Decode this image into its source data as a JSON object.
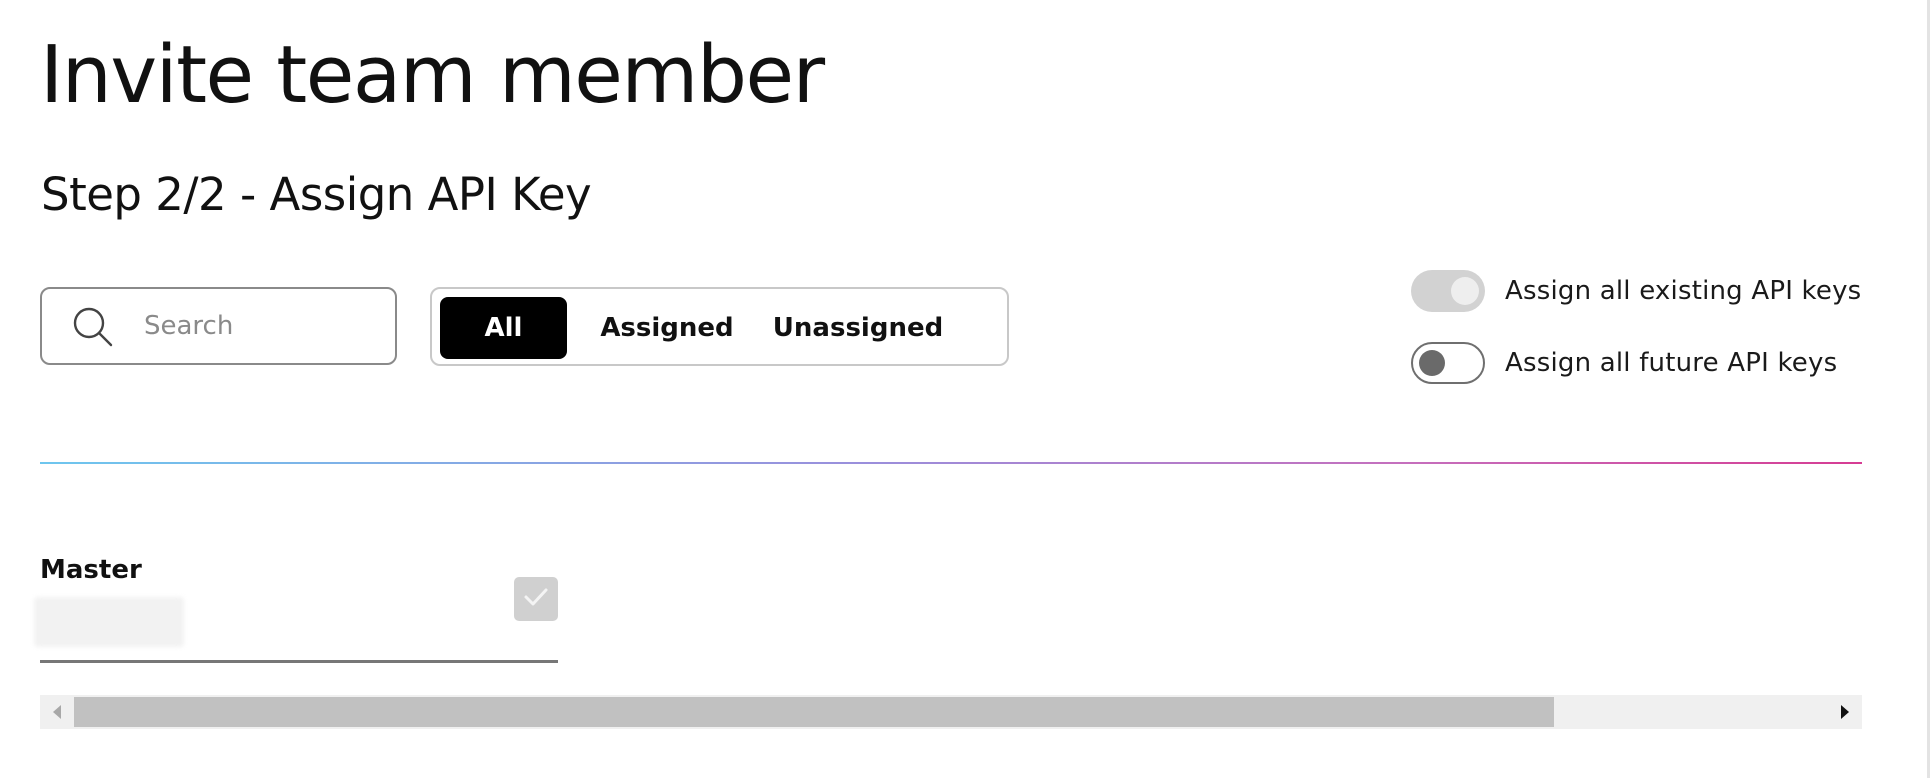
{
  "header": {
    "title": "Invite team member",
    "step_title": "Step 2/2 - Assign API Key"
  },
  "search": {
    "placeholder": "Search",
    "value": "",
    "icon": "search-icon"
  },
  "filters": {
    "options": [
      "All",
      "Assigned",
      "Unassigned"
    ],
    "selected": "All"
  },
  "toggles": [
    {
      "label": "Assign all existing API keys",
      "state": "on",
      "enabled": false
    },
    {
      "label": "Assign all future API keys",
      "state": "off",
      "enabled": true
    }
  ],
  "divider": {
    "gradient_colors": [
      "#6ec6ee",
      "#9a8fdc",
      "#c56fbd",
      "#d63c93"
    ]
  },
  "api_keys": [
    {
      "name": "Master",
      "checked": true,
      "checkbox_enabled": false
    }
  ],
  "scrollbar": {
    "orientation": "horizontal",
    "left_arrow_icon": "caret-left-icon",
    "right_arrow_icon": "caret-right-icon"
  },
  "colors": {
    "active_filter_bg": "#000000",
    "active_filter_text": "#ffffff",
    "toggle_disabled": "#d2d2d2"
  }
}
